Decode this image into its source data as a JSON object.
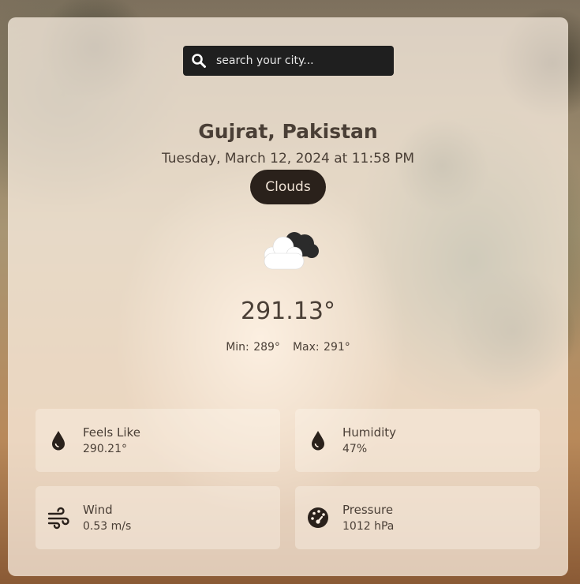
{
  "search": {
    "placeholder": "search your city..."
  },
  "location": {
    "city": "Gujrat, Pakistan",
    "datetime": "Tuesday, March 12, 2024 at 11:58 PM"
  },
  "weather": {
    "condition": "Clouds",
    "icon": "clouds-icon",
    "temperature": "291.13°",
    "min": "Min: 289°",
    "max": "Max: 291°"
  },
  "details": [
    {
      "label": "Feels Like",
      "value": "290.21°",
      "icon": "droplet-icon"
    },
    {
      "label": "Humidity",
      "value": "47%",
      "icon": "droplet-icon"
    },
    {
      "label": "Wind",
      "value": "0.53 m/s",
      "icon": "wind-icon"
    },
    {
      "label": "Pressure",
      "value": "1012 hPa",
      "icon": "gauge-icon"
    }
  ],
  "colors": {
    "text": "#4a3f36",
    "search_bg": "#1f1f1f",
    "badge_bg": "#2a211b"
  }
}
